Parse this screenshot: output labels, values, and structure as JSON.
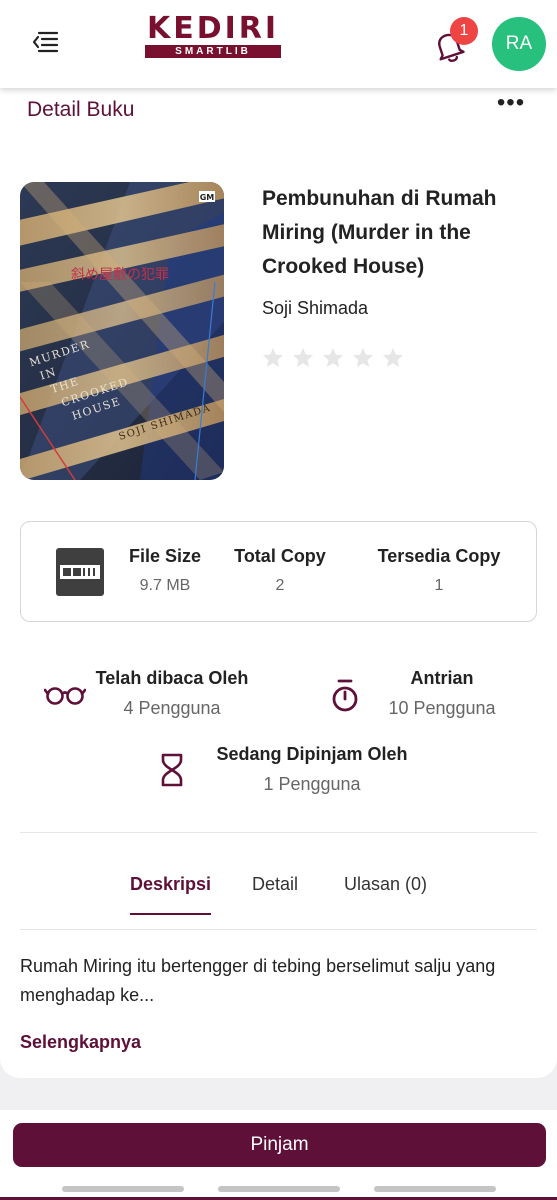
{
  "header": {
    "logo_main": "KEDIRI",
    "logo_sub": "SMARTLIB",
    "notification_count": "1",
    "avatar_initials": "RA"
  },
  "page": {
    "title": "Detail Buku",
    "more_label": "•••"
  },
  "book": {
    "title": "Pembunuhan di Rumah Miring (Murder in the Crooked House)",
    "author": "Soji Shimada",
    "rating": 0,
    "rating_max": 5,
    "cover": {
      "jp_title": "斜め屋敷の犯罪",
      "en_title_lines": [
        "MURDER",
        "IN",
        "THE",
        "CROOKED",
        "HOUSE"
      ],
      "author": "SOJI SHIMADA",
      "publisher_mark": "GM"
    }
  },
  "info": {
    "drm_label": "DRM",
    "file_size_label": "File Size",
    "file_size_value": "9.7 MB",
    "total_copy_label": "Total Copy",
    "total_copy_value": "2",
    "available_copy_label": "Tersedia Copy",
    "available_copy_value": "1"
  },
  "stats": {
    "read_label": "Telah dibaca Oleh",
    "read_value": "4 Pengguna",
    "queue_label": "Antrian",
    "queue_value": "10 Pengguna",
    "borrowed_label": "Sedang Dipinjam Oleh",
    "borrowed_value": "1 Pengguna"
  },
  "tabs": [
    {
      "label": "Deskripsi",
      "active": true
    },
    {
      "label": "Detail",
      "active": false
    },
    {
      "label": "Ulasan (0)",
      "active": false
    }
  ],
  "description": {
    "text": "Rumah Miring itu bertengger di tebing berselimut salju yang menghadap ke...",
    "more_label": "Selengkapnya"
  },
  "action": {
    "borrow_label": "Pinjam"
  },
  "colors": {
    "brand": "#5e1038",
    "logo": "#7a1030",
    "badge": "#ef4444",
    "avatar": "#27c07d",
    "star_empty": "#e6e6e6"
  }
}
